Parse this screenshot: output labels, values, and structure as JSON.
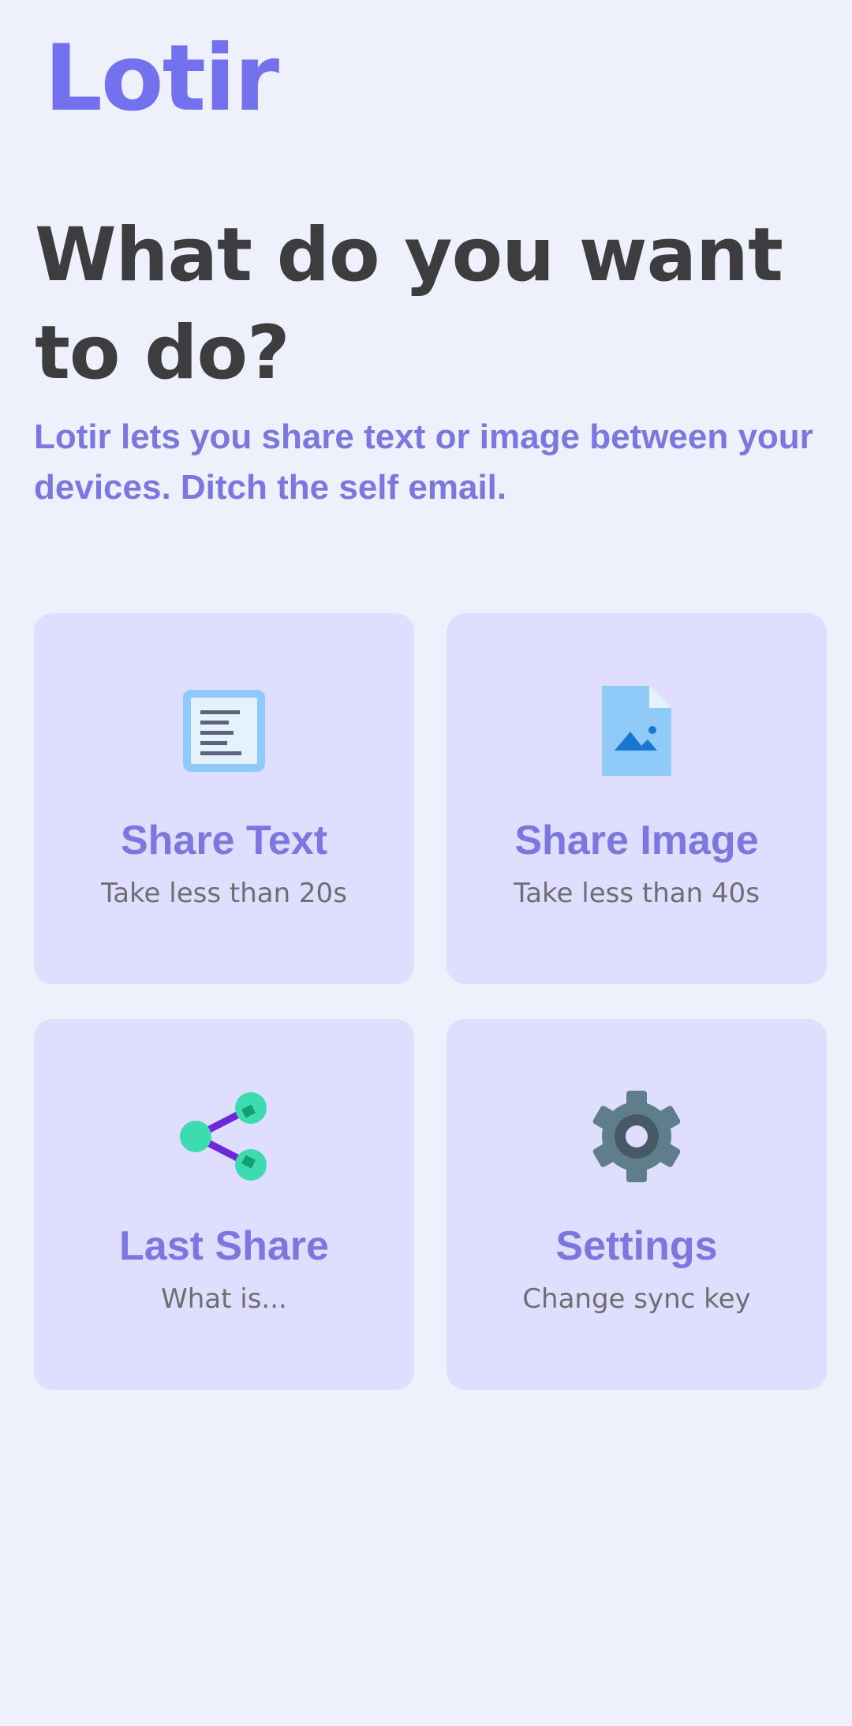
{
  "app": {
    "logo": "Lotir"
  },
  "header": {
    "headline": "What do you want to do?",
    "subtitle": "Lotir lets you share text or image between your devices. Ditch the self email."
  },
  "actions": [
    {
      "title": "Share Text",
      "caption": "Take less than 20s",
      "icon": "text-document-icon"
    },
    {
      "title": "Share Image",
      "caption": "Take less than 40s",
      "icon": "image-file-icon"
    },
    {
      "title": "Last Share",
      "caption": "What is...",
      "icon": "share-icon"
    },
    {
      "title": "Settings",
      "caption": "Change sync key",
      "icon": "gear-icon"
    }
  ],
  "colors": {
    "background": "#eef0fc",
    "card": "#dfdefe",
    "accent": "#7471ee",
    "headline": "#3d3d40",
    "caption": "#6e6e72"
  }
}
